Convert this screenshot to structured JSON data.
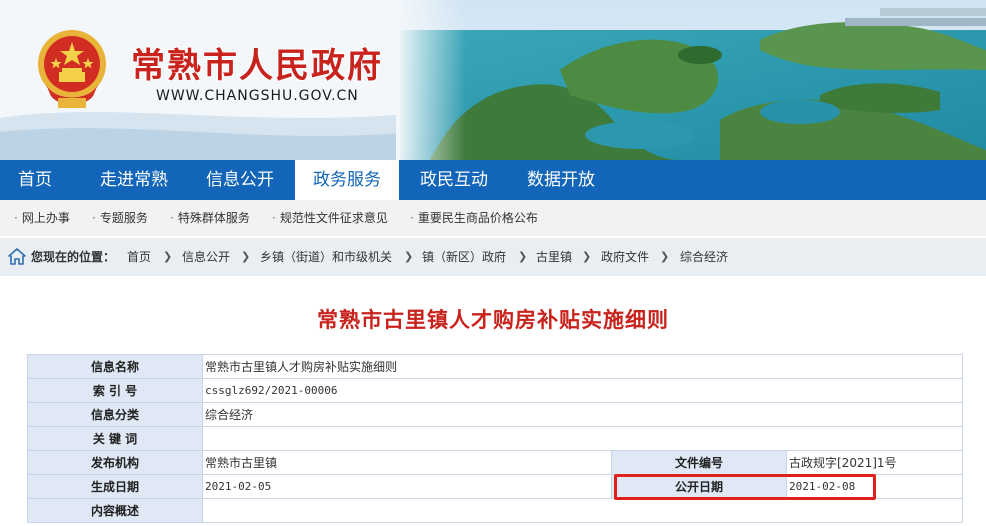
{
  "header": {
    "site_title": "常熟市人民政府",
    "site_url": "WWW.CHANGSHU.GOV.CN"
  },
  "main_nav": {
    "items": [
      {
        "label": "首页",
        "active": false
      },
      {
        "label": "走进常熟",
        "active": false
      },
      {
        "label": "信息公开",
        "active": false
      },
      {
        "label": "政务服务",
        "active": true
      },
      {
        "label": "政民互动",
        "active": false
      },
      {
        "label": "数据开放",
        "active": false
      }
    ]
  },
  "sub_nav": {
    "items": [
      {
        "label": "网上办事"
      },
      {
        "label": "专题服务"
      },
      {
        "label": "特殊群体服务"
      },
      {
        "label": "规范性文件征求意见"
      },
      {
        "label": "重要民生商品价格公布"
      }
    ]
  },
  "breadcrumb": {
    "label": "您现在的位置：",
    "items": [
      "首页",
      "信息公开",
      "乡镇（街道）和市级机关",
      "镇（新区）政府",
      "古里镇",
      "政府文件",
      "综合经济"
    ]
  },
  "article": {
    "title": "常熟市古里镇人才购房补贴实施细则"
  },
  "meta": {
    "info_name_label": "信息名称",
    "info_name": "常熟市古里镇人才购房补贴实施细则",
    "index_no_label": "索 引 号",
    "index_no": "cssglz692/2021-00006",
    "category_label": "信息分类",
    "category": "综合经济",
    "keywords_label": "关 键 词",
    "keywords": "",
    "publisher_label": "发布机构",
    "publisher": "常熟市古里镇",
    "doc_no_label": "文件编号",
    "doc_no": "古政规字[2021]1号",
    "created_label": "生成日期",
    "created": "2021-02-05",
    "published_label": "公开日期",
    "published": "2021-02-08",
    "summary_label": "内容概述",
    "summary": ""
  },
  "colors": {
    "nav_blue": "#1265b8",
    "title_red": "#c8231d",
    "highlight_red": "#e0211b",
    "label_bg": "#dfe8f4"
  }
}
